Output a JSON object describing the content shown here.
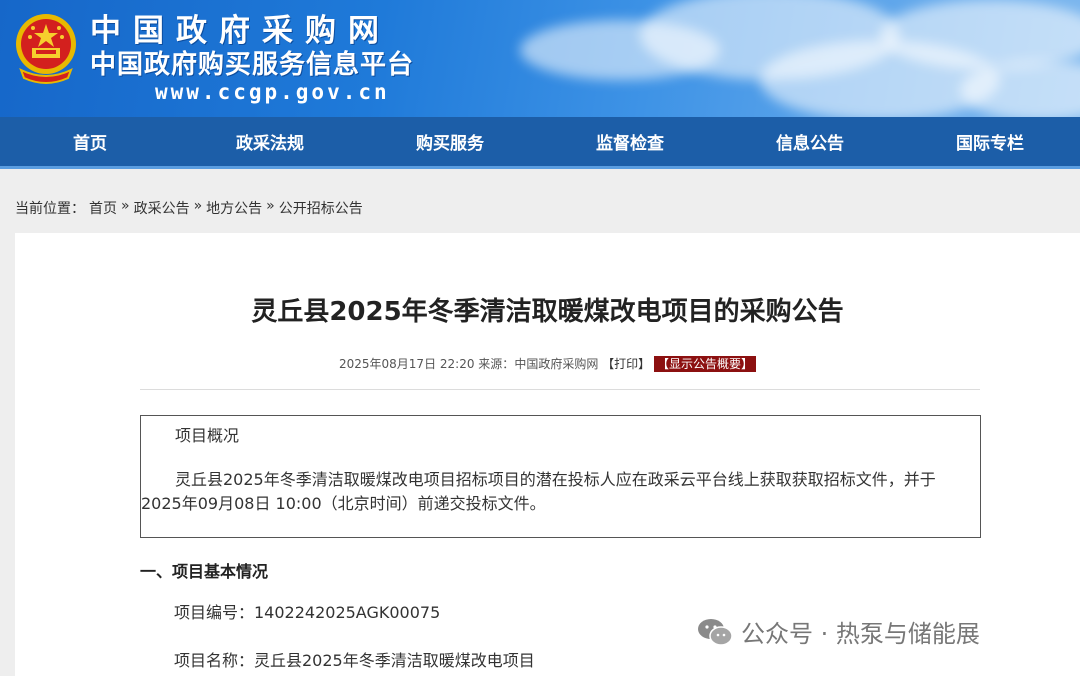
{
  "header": {
    "site_name": "中国政府采购网",
    "site_subtitle": "中国政府购买服务信息平台",
    "site_url": "www.ccgp.gov.cn"
  },
  "nav": {
    "items": [
      "首页",
      "政采法规",
      "购买服务",
      "监督检查",
      "信息公告",
      "国际专栏"
    ]
  },
  "breadcrumb": {
    "label": "当前位置：",
    "items": [
      "首页",
      "政采公告",
      "地方公告",
      "公开招标公告"
    ],
    "separator": "»"
  },
  "article": {
    "title": "灵丘县2025年冬季清洁取暖煤改电项目的采购公告",
    "date": "2025年08月17日 22:20",
    "source_label": "来源：",
    "source": "中国政府采购网",
    "print_label": "【打印】",
    "summary_label": "【显示公告概要】",
    "overview_heading": "项目概况",
    "overview_text": "灵丘县2025年冬季清洁取暖煤改电项目招标项目的潜在投标人应在政采云平台线上获取获取招标文件，并于2025年09月08日 10:00（北京时间）前递交投标文件。",
    "section_heading": "一、项目基本情况",
    "project_number": "项目编号：1402242025AGK00075",
    "project_name": "项目名称：灵丘县2025年冬季清洁取暖煤改电项目"
  },
  "watermark": {
    "text": "公众号 · 热泵与储能展"
  },
  "colors": {
    "nav_bg": "#1c5ea8",
    "summary_badge": "#8c1010"
  }
}
